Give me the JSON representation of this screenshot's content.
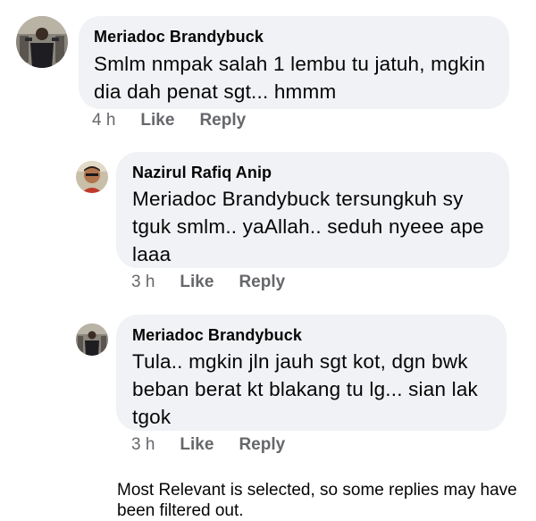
{
  "comments": [
    {
      "author": "Meriadoc Brandybuck",
      "text": "Smlm nmpak salah 1 lembu tu jatuh, mgkin dia dah penat sgt... hmmm",
      "time": "4 h",
      "like_label": "Like",
      "reply_label": "Reply"
    },
    {
      "author": "Nazirul Rafiq Anip",
      "text": "Meriadoc Brandybuck tersungkuh  sy tguk smlm.. yaAllah.. seduh nyeee ape laaa",
      "time": "3 h",
      "like_label": "Like",
      "reply_label": "Reply"
    },
    {
      "author": "Meriadoc Brandybuck",
      "text": "Tula.. mgkin jln jauh sgt kot, dgn bwk beban berat kt blakang tu lg... sian lak tgok",
      "time": "3 h",
      "like_label": "Like",
      "reply_label": "Reply"
    }
  ],
  "filter_notice": "Most Relevant is selected, so some replies may have been filtered out.",
  "colors": {
    "bubble": "#f0f2f5",
    "meta_text": "#65676b",
    "primary_text": "#050505"
  }
}
